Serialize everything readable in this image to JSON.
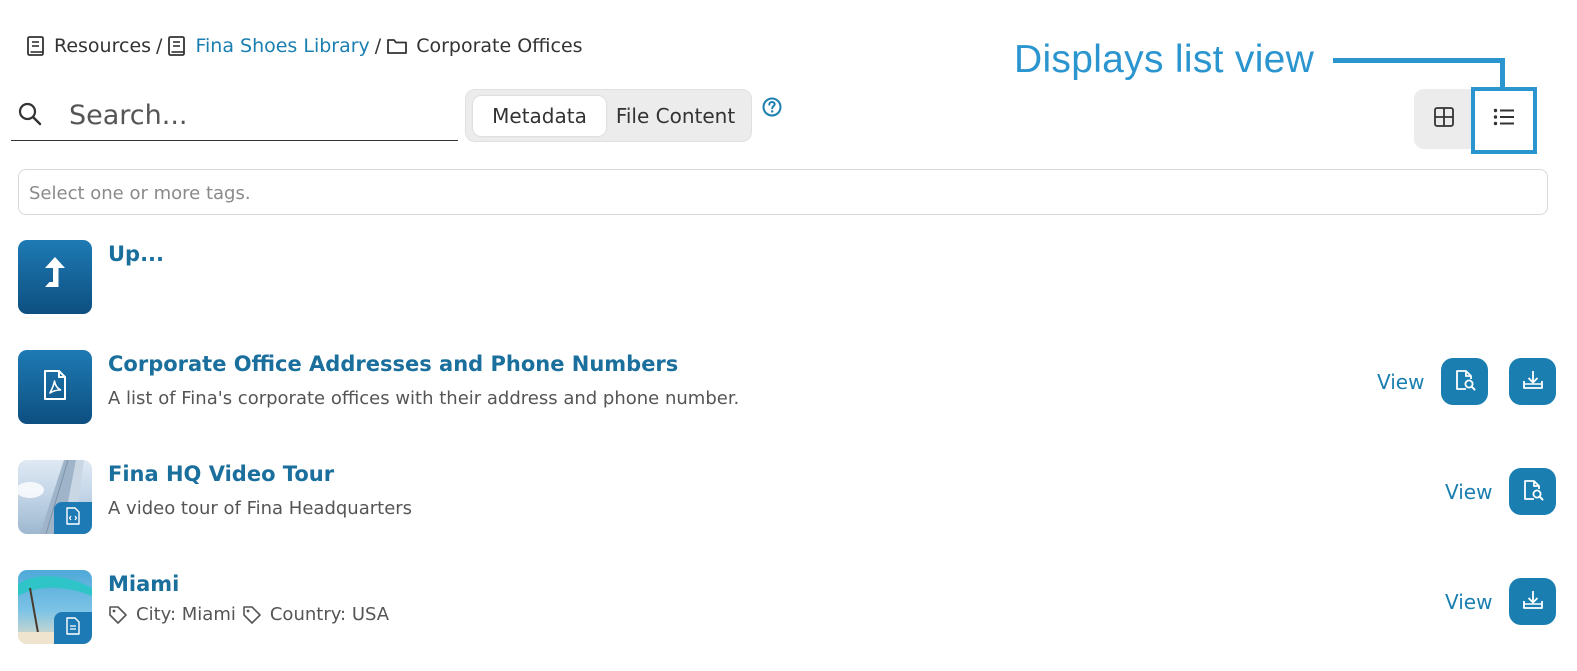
{
  "breadcrumb": {
    "root": "Resources",
    "library": "Fina Shoes Library",
    "current": "Corporate Offices",
    "separator": "/"
  },
  "annotation": {
    "text": "Displays list view",
    "color": "#2a95cf"
  },
  "search": {
    "placeholder": "Search..."
  },
  "search_mode": {
    "options": [
      "Metadata",
      "File Content"
    ],
    "selected": "Metadata"
  },
  "view_toggle": {
    "options": [
      "grid-icon",
      "list-icon"
    ],
    "selected": "list-icon"
  },
  "tags": {
    "placeholder": "Select one or more tags."
  },
  "items": [
    {
      "title": "Up...",
      "type": "up",
      "icon": "up-arrow-icon"
    },
    {
      "title": "Corporate Office Addresses and Phone Numbers",
      "description": "A list of Fina's corporate offices with their address and phone number.",
      "icon": "pdf-icon",
      "view_label": "View",
      "actions": [
        "preview-button",
        "download-button"
      ]
    },
    {
      "title": "Fina HQ Video Tour",
      "description": "A video tour of Fina Headquarters",
      "icon": "code-file-icon",
      "view_label": "View",
      "actions": [
        "preview-button"
      ]
    },
    {
      "title": "Miami",
      "tags": [
        "City: Miami",
        "Country: USA"
      ],
      "icon": "document-icon",
      "view_label": "View",
      "actions": [
        "download-button"
      ]
    }
  ],
  "colors": {
    "accent": "#1a7fb0",
    "title": "#1a6f9c",
    "annotation": "#2a95cf"
  }
}
